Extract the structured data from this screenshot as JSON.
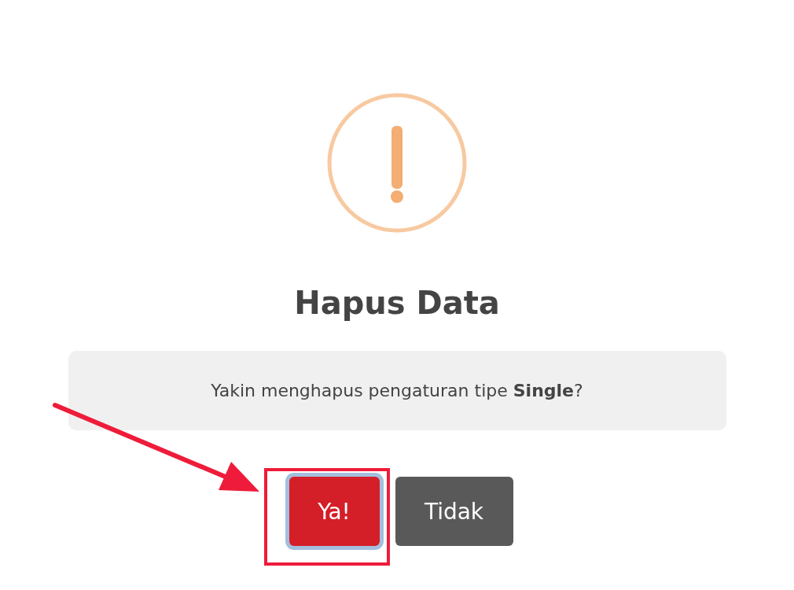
{
  "dialog": {
    "title": "Hapus Data",
    "message": "Yakin menghapus pengaturan tipe **Single**?",
    "buttons": [
      {
        "label": "Ya!",
        "kind": "confirm",
        "focused": true
      },
      {
        "label": "Tidak",
        "kind": "cancel",
        "focused": false
      }
    ]
  }
}
